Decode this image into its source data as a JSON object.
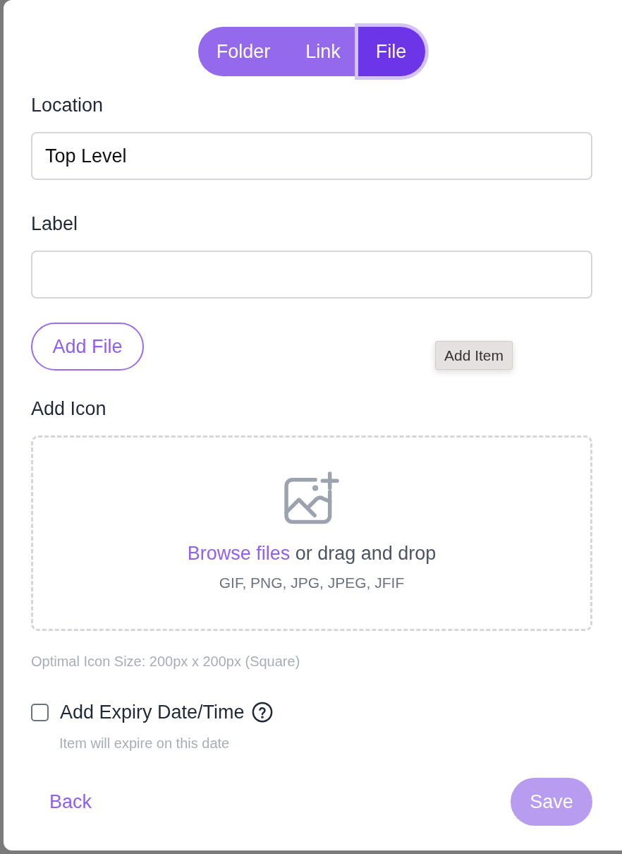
{
  "tabs": [
    {
      "label": "Folder",
      "selected": false
    },
    {
      "label": "Link",
      "selected": false
    },
    {
      "label": "File",
      "selected": true
    }
  ],
  "fields": [
    {
      "label": "Location",
      "value": "Top Level"
    },
    {
      "label": "Label"
    }
  ],
  "add_file_button": "Add File",
  "tooltip": "Add Item",
  "icon_upload": {
    "label": "Add Icon",
    "link": "Browse files",
    "text": "or drag and drop",
    "formats": "GIF, PNG, JPG, JPEG, JFIF",
    "hint": "Optimal Icon Size: 200px x 200px (Square)"
  },
  "expiry": {
    "label": "Add Expiry Date/Time",
    "checked": false,
    "hint": "Item will expire on this date"
  },
  "footer": {
    "back": "Back",
    "save": {
      "label": "Save",
      "disabled": true
    }
  }
}
